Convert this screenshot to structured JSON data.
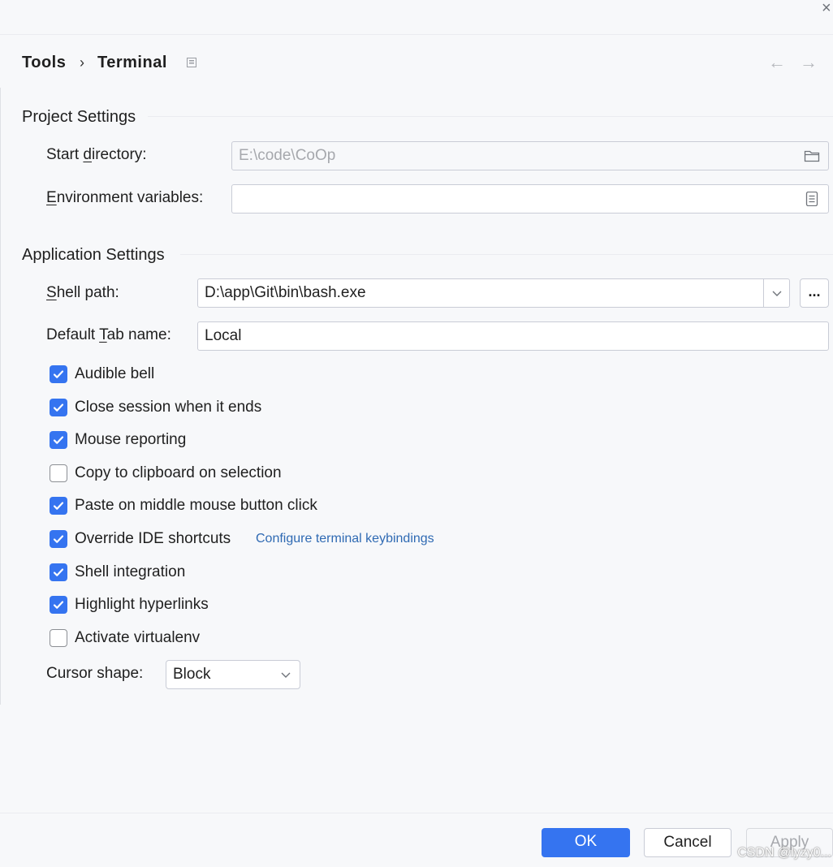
{
  "window": {
    "close_glyph": "×"
  },
  "breadcrumb": {
    "items": [
      "Tools",
      "Terminal"
    ],
    "separator": "›",
    "icon": "pin-page-icon"
  },
  "nav": {
    "back": "←",
    "forward": "→"
  },
  "project_settings": {
    "title": "Project Settings",
    "start_directory": {
      "label_pre": "Start ",
      "label_mnemonic": "d",
      "label_post": "irectory:",
      "placeholder": "E:\\code\\CoOp",
      "icon": "folder-icon"
    },
    "env_vars": {
      "label_mnemonic": "E",
      "label_post": "nvironment variables:",
      "value": "",
      "icon": "document-list-icon"
    }
  },
  "application_settings": {
    "title": "Application Settings",
    "shell_path": {
      "label_mnemonic": "S",
      "label_post": "hell path:",
      "value": "D:\\app\\Git\\bin\\bash.exe",
      "browse_label": "..."
    },
    "default_tab_name": {
      "label_pre": "Default ",
      "label_mnemonic": "T",
      "label_post": "ab name:",
      "value": "Local"
    },
    "checkboxes": [
      {
        "label": "Audible bell",
        "checked": true
      },
      {
        "label": "Close session when it ends",
        "checked": true
      },
      {
        "label": "Mouse reporting",
        "checked": true
      },
      {
        "label": "Copy to clipboard on selection",
        "checked": false
      },
      {
        "label": "Paste on middle mouse button click",
        "checked": true
      },
      {
        "label": "Override IDE shortcuts",
        "checked": true
      },
      {
        "label": "Shell integration",
        "checked": true
      },
      {
        "label": "Highlight hyperlinks",
        "checked": true
      },
      {
        "label": "Activate virtualenv",
        "checked": false
      }
    ],
    "keybindings_link": "Configure terminal keybindings",
    "cursor_shape": {
      "label": "Cursor shape:",
      "value": "Block"
    }
  },
  "footer": {
    "ok": "OK",
    "cancel": "Cancel",
    "apply": "Apply",
    "watermark": "CSDN @lyzy0..."
  },
  "colors": {
    "accent": "#3574f0",
    "link": "#2f6ab3",
    "background": "#f7f8fa"
  }
}
